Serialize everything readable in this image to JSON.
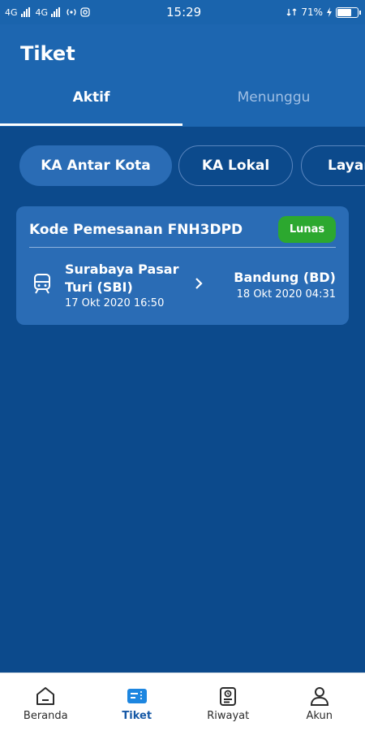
{
  "status_bar": {
    "net1": "4G",
    "net2": "4G",
    "time": "15:29",
    "battery": "71%",
    "battery_level": 0.71
  },
  "header": {
    "title": "Tiket",
    "tabs": [
      {
        "label": "Aktif",
        "active": true
      },
      {
        "label": "Menunggu",
        "active": false
      }
    ]
  },
  "filters": [
    {
      "label": "KA Antar Kota",
      "active": true
    },
    {
      "label": "KA Lokal",
      "active": false
    },
    {
      "label": "Layan",
      "active": false
    }
  ],
  "ticket": {
    "booking_label": "Kode Pemesanan FNH3DPD",
    "status": "Lunas",
    "origin": {
      "name": "Surabaya Pasar Turi (SBI)",
      "datetime": "17 Okt 2020 16:50"
    },
    "destination": {
      "name": "Bandung (BD)",
      "datetime": "18 Okt 2020 04:31"
    }
  },
  "bottom_nav": [
    {
      "label": "Beranda",
      "icon": "home-icon",
      "active": false
    },
    {
      "label": "Tiket",
      "icon": "ticket-icon",
      "active": true
    },
    {
      "label": "Riwayat",
      "icon": "history-icon",
      "active": false
    },
    {
      "label": "Akun",
      "icon": "user-icon",
      "active": false
    }
  ],
  "colors": {
    "background": "#0c4a8c",
    "header": "#1d66b0",
    "card": "#2a6cb5",
    "badge": "#2ca82f",
    "nav_active": "#1659a6"
  }
}
